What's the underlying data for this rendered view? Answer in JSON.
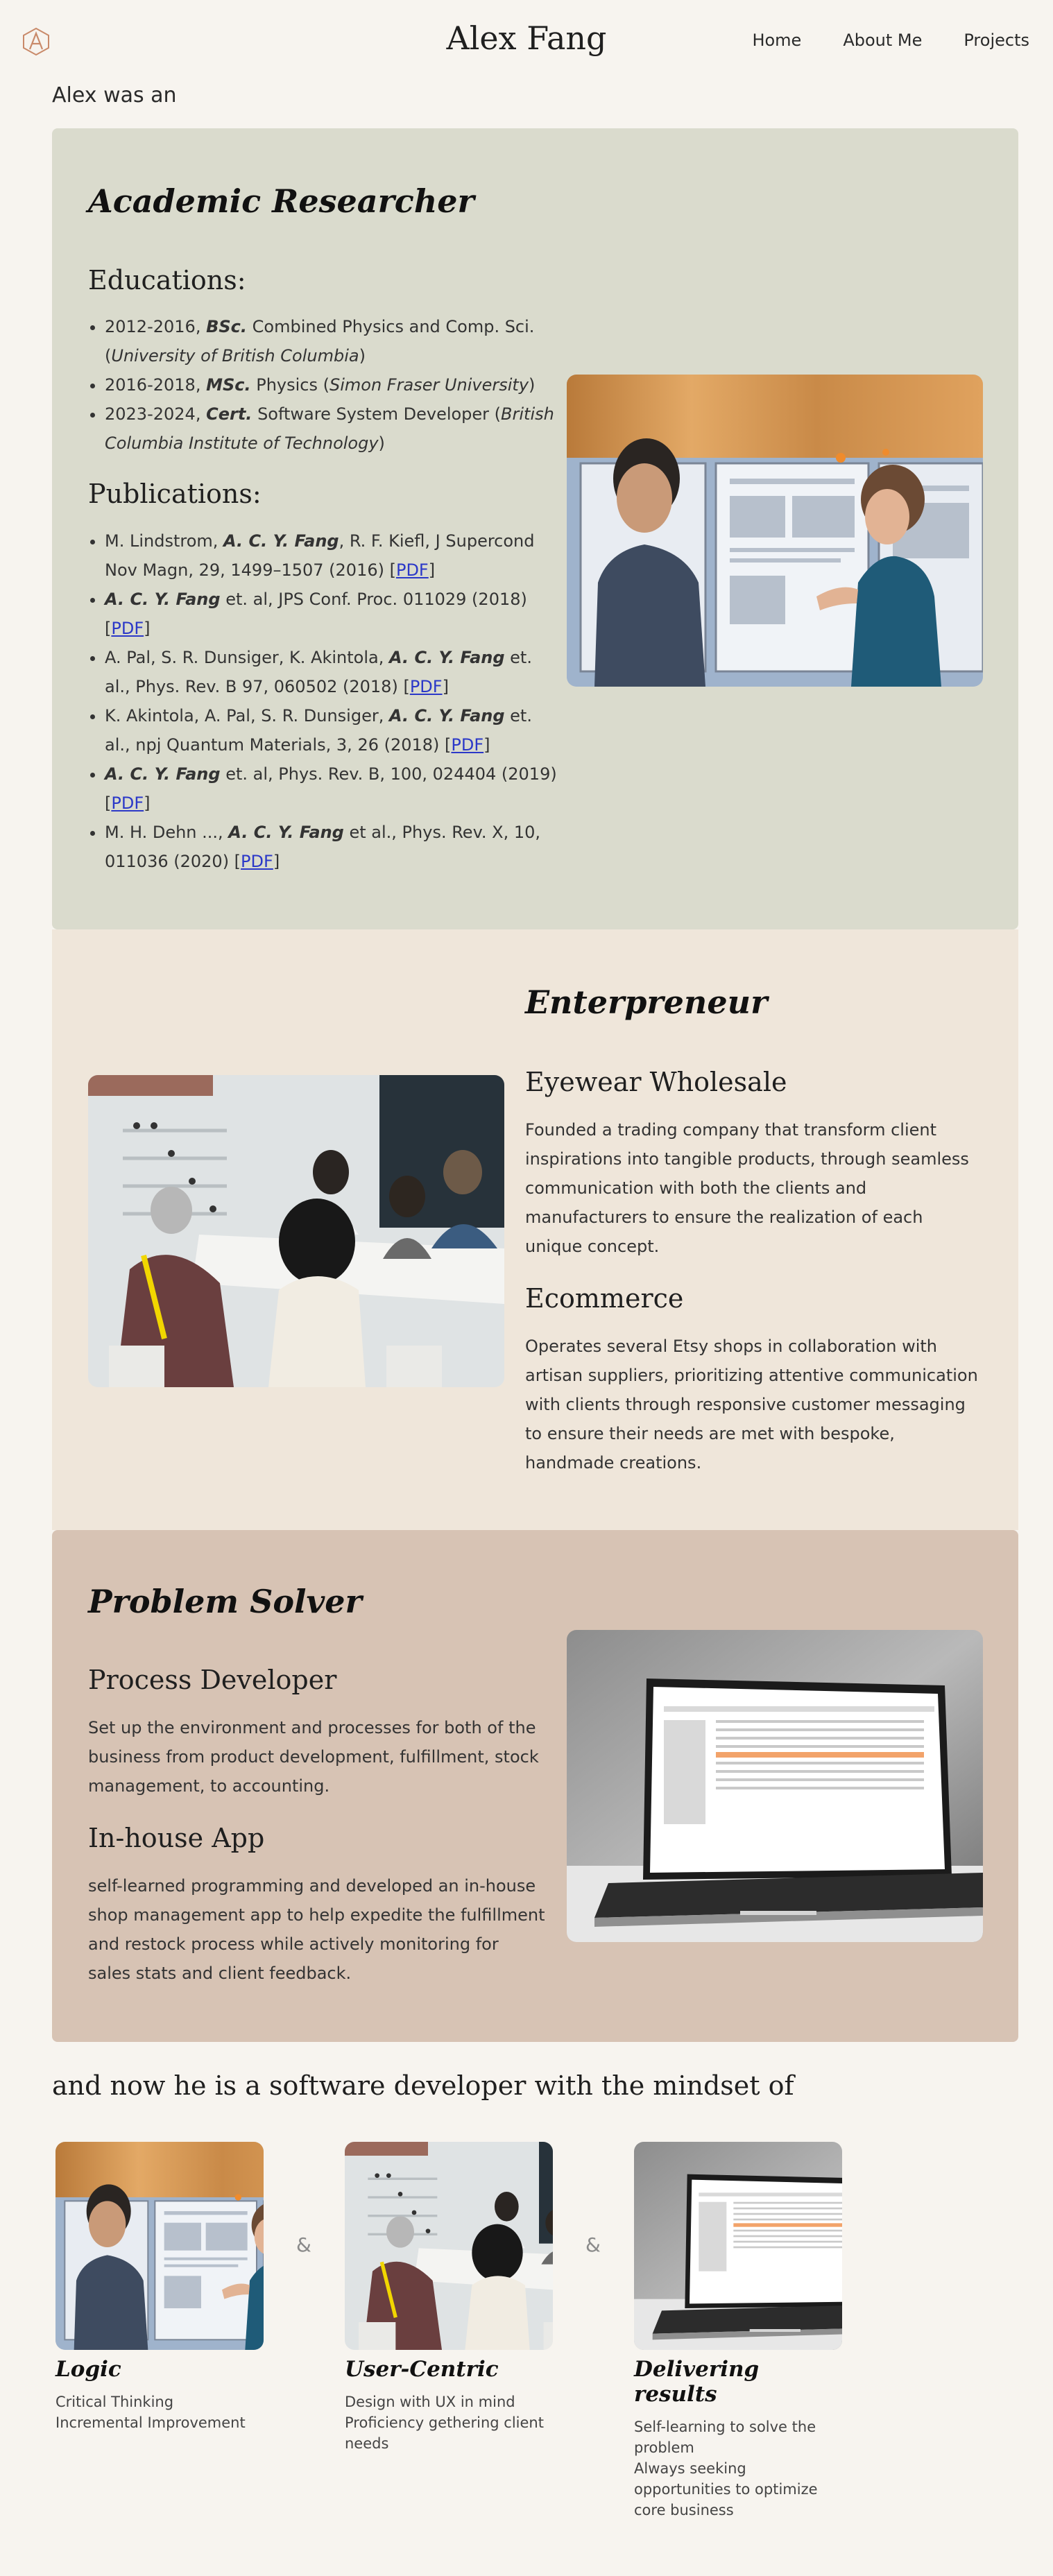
{
  "header": {
    "site_title": "Alex Fang",
    "logo_icon": "letter-a-logo-icon",
    "nav": [
      "Home",
      "About Me",
      "Projects"
    ]
  },
  "intro": "Alex was an",
  "research": {
    "title": "Academic Researcher",
    "educations_heading": "Educations:",
    "educations": [
      {
        "years": "2012-2016,",
        "degree": "BSc.",
        "field": "Combined Physics and Comp. Sci. (",
        "school": "University of British Columbia",
        "end": ")"
      },
      {
        "years": "2016-2018,",
        "degree": "MSc.",
        "field": "Physics (",
        "school": "Simon Fraser University",
        "end": ")"
      },
      {
        "years": "2023-2024,",
        "degree": "Cert.",
        "field": "Software System Developer (",
        "school": "British Columbia Institute of Technology",
        "end": ")"
      }
    ],
    "publications_heading": "Publications:",
    "publications": [
      {
        "before": "M. Lindstrom, ",
        "author": "A. C. Y. Fang",
        "after": ", R. F. Kiefl, J Supercond Nov Magn, 29, 1499–1507 (2016) [",
        "link": "PDF",
        "close": "]"
      },
      {
        "before": "",
        "author": "A. C. Y. Fang",
        "after": " et. al, JPS Conf. Proc. 011029 (2018) [",
        "link": "PDF",
        "close": "]"
      },
      {
        "before": "A. Pal, S. R. Dunsiger, K. Akintola, ",
        "author": "A. C. Y. Fang",
        "after": " et. al., Phys. Rev. B 97, 060502 (2018) [",
        "link": "PDF",
        "close": "]"
      },
      {
        "before": "K. Akintola, A. Pal, S. R. Dunsiger, ",
        "author": "A. C. Y. Fang",
        "after": " et. al., npj Quantum Materials, 3, 26 (2018) [",
        "link": "PDF",
        "close": "]"
      },
      {
        "before": "",
        "author": "A. C. Y. Fang",
        "after": " et. al, Phys. Rev. B, 100, 024404 (2019) [",
        "link": "PDF",
        "close": "]"
      },
      {
        "before": "M. H. Dehn ..., ",
        "author": "A. C. Y. Fang",
        "after": " et al., Phys. Rev. X, 10, 011036 (2020) [",
        "link": "PDF",
        "close": "]"
      }
    ]
  },
  "entrepreneur": {
    "title": "Enterpreneur",
    "eyewear_heading": "Eyewear Wholesale",
    "eyewear_text": "Founded a trading company that transform client inspirations into tangible products, through seamless communication with both the clients and manufacturers to ensure the realization of each unique concept.",
    "ecommerce_heading": "Ecommerce",
    "ecommerce_text": "Operates several Etsy shops in collaboration with artisan suppliers, prioritizing attentive communication with clients through responsive customer messaging to ensure their needs are met with bespoke, handmade creations."
  },
  "problem_solver": {
    "title": "Problem Solver",
    "process_heading": "Process Developer",
    "process_text": "Set up the environment and processes for both of the business from product development, fulfillment, stock management, to accounting.",
    "app_heading": "In-house App",
    "app_text": "self-learned programming and developed an in-house shop management app to help expedite the fulfillment and restock process while actively monitoring for sales stats and client feedback."
  },
  "mindset": {
    "title": "and now he is a software developer with the mindset of",
    "separator": "&",
    "cards": [
      {
        "title": "Logic",
        "lines": [
          "Critical Thinking",
          "Incremental Improvement"
        ]
      },
      {
        "title": "User-Centric",
        "lines": [
          "Design with UX in mind",
          "Proficiency gethering client",
          "needs"
        ]
      },
      {
        "title": "Delivering results",
        "lines": [
          "Self-learning to solve the",
          "problem",
          "Always seeking",
          "opportunities to optimize",
          "core business"
        ]
      }
    ]
  },
  "colors": {
    "page_bg": "#f7f4ef",
    "research_bg": "#dadbcd",
    "entrepreneur_bg": "#efe6da",
    "problem_bg": "#d7c3b4",
    "link": "#2b38c8"
  }
}
